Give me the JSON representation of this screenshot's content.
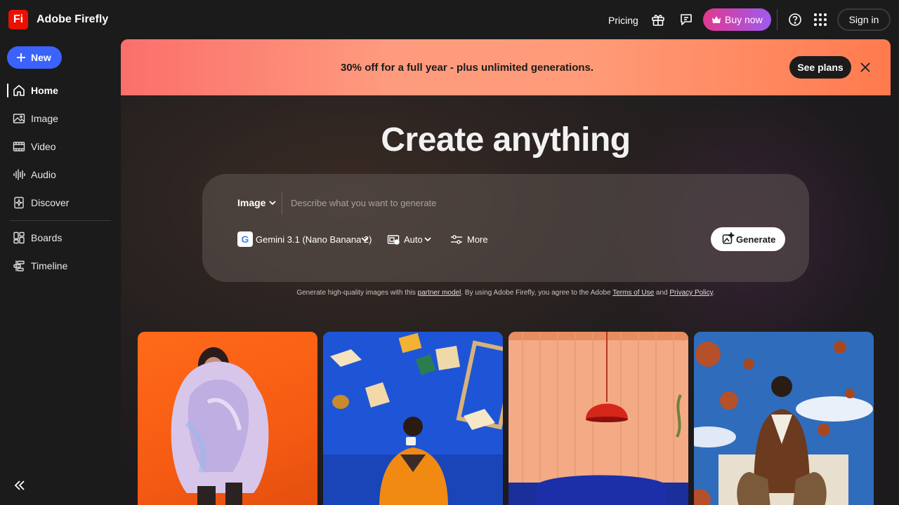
{
  "app": {
    "logo_text": "Fi",
    "name": "Adobe Firefly",
    "accent": "#eb1000"
  },
  "topbar": {
    "pricing_label": "Pricing",
    "gift_icon": "gift-icon",
    "chat_icon": "chat-icon",
    "buy_label": "Buy now",
    "help_icon": "help-icon",
    "apps_icon": "apps-grid-icon",
    "signin_label": "Sign in"
  },
  "sidebar": {
    "new_label": "New",
    "items": [
      {
        "label": "Home",
        "icon": "home-icon",
        "active": true
      },
      {
        "label": "Image",
        "icon": "image-icon"
      },
      {
        "label": "Video",
        "icon": "video-icon"
      },
      {
        "label": "Audio",
        "icon": "audio-icon"
      },
      {
        "label": "Discover",
        "icon": "discover-icon"
      },
      {
        "label": "Boards",
        "icon": "boards-icon"
      },
      {
        "label": "Timeline",
        "icon": "timeline-icon"
      }
    ]
  },
  "promo": {
    "text": "30% off for a full year - plus unlimited generations.",
    "cta_label": "See plans"
  },
  "hero": {
    "title": "Create anything"
  },
  "prompt": {
    "type_label": "Image",
    "placeholder": "Describe what you want to generate",
    "model_badge": "G",
    "model_label": "Gemini 3.1 (Nano Banana 2)",
    "aspect_label": "Auto",
    "more_label": "More",
    "generate_label": "Generate"
  },
  "disclaimer": {
    "part1": "Generate high-quality images with this ",
    "link1": "partner model",
    "part2": ". By using Adobe Firefly, you agree to the Adobe ",
    "link2": "Terms of Use",
    "part3": " and ",
    "link3": "Privacy Policy",
    "part4": "."
  },
  "gallery": [
    {
      "subject": "person-in-iridescent-puffer-jacket"
    },
    {
      "subject": "man-with-flying-books"
    },
    {
      "subject": "red-pendant-lamp-room"
    },
    {
      "subject": "man-with-floating-basketballs"
    }
  ]
}
